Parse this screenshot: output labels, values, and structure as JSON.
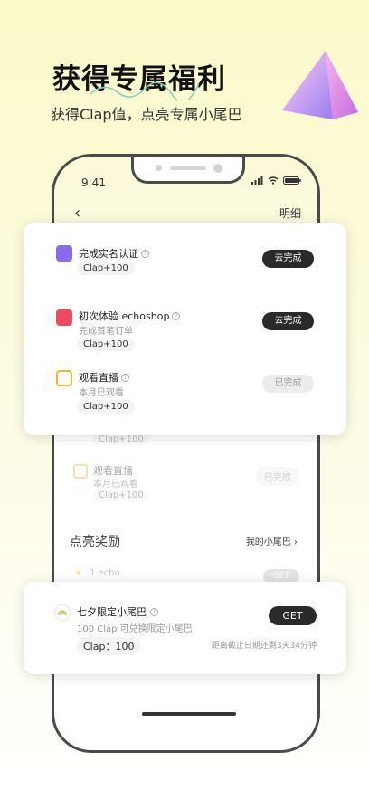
{
  "promo": {
    "title": "获得专属福利",
    "subtitle": "获得Clap值，点亮专属小尾巴"
  },
  "status_bar": {
    "time": "9:41"
  },
  "header": {
    "back_icon": "chevron-left-icon",
    "detail_label": "明细"
  },
  "tasks": [
    {
      "name": "完成实名认证",
      "desc": "",
      "reward": "Clap+100",
      "button": "去完成",
      "done": false,
      "icon": "id-card-icon",
      "color": "#8a6bf0"
    },
    {
      "name": "初次体验 echoshop",
      "desc": "完成首笔订单",
      "reward": "Clap+100",
      "button": "去完成",
      "done": false,
      "icon": "shopping-bag-icon",
      "color": "#f04a5e"
    },
    {
      "name": "观看直播",
      "desc": "本月已观看",
      "reward": "Clap+100",
      "button": "已完成",
      "done": true,
      "icon": "tv-icon",
      "color": "#f3b425"
    }
  ],
  "background_list": {
    "ghost_reward": "Clap+100",
    "ghost_task_name": "观看直播",
    "ghost_task_desc": "本月已观看",
    "ghost_task_reward": "Clap+100",
    "ghost_task_button": "已完成"
  },
  "rewards": {
    "section_title": "点亮奖励",
    "my_tails_label": "我的小尾巴",
    "echo_label": "1 echo",
    "echo_button": "GET"
  },
  "reward_card": {
    "title": "七夕限定小尾巴",
    "desc": "100 Clap 可兑换限定小尾巴",
    "cost": "Clap：100",
    "button": "GET",
    "deadline": "距离截止日期还剩3天34分钟"
  }
}
